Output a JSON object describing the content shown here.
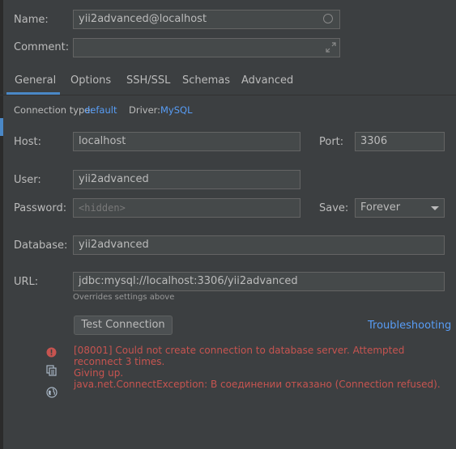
{
  "general": {
    "name_label": "Name:",
    "name_value": "yii2advanced@localhost",
    "comment_label": "Comment:",
    "comment_value": ""
  },
  "tabs": [
    {
      "label": "General",
      "active": true
    },
    {
      "label": "Options"
    },
    {
      "label": "SSH/SSL"
    },
    {
      "label": "Schemas"
    },
    {
      "label": "Advanced"
    }
  ],
  "connection": {
    "type_label": "Connection type:",
    "type_value": "default",
    "driver_label": "Driver:",
    "driver_value": "MySQL"
  },
  "form": {
    "host_label": "Host:",
    "host_value": "localhost",
    "port_label": "Port:",
    "port_value": "3306",
    "user_label": "User:",
    "user_value": "yii2advanced",
    "password_label": "Password:",
    "password_placeholder": "<hidden>",
    "save_label": "Save:",
    "save_value": "Forever",
    "database_label": "Database:",
    "database_value": "yii2advanced",
    "url_label": "URL:",
    "url_value": "jdbc:mysql://localhost:3306/yii2advanced",
    "url_hint": "Overrides settings above"
  },
  "actions": {
    "test_connection": "Test Connection",
    "troubleshooting": "Troubleshooting"
  },
  "error": {
    "line1": "[08001] Could not create connection to database server. Attempted reconnect 3 times.",
    "line2": "Giving up.",
    "line3": "java.net.ConnectException: В соединении отказано (Connection refused)."
  },
  "colors": {
    "background": "#3c3f41",
    "accent": "#4a88c7",
    "link": "#589df6",
    "error": "#c75450"
  }
}
